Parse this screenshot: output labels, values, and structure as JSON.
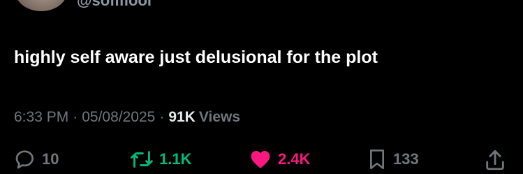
{
  "author": {
    "handle": "@sofiflool"
  },
  "tweet": {
    "text": "highly self aware just delusional for the plot",
    "time": "6:33 PM",
    "separator": "·",
    "date": "05/08/2025",
    "views_count": "91K",
    "views_label": "Views"
  },
  "actions": {
    "replies": "10",
    "reposts": "1.1K",
    "likes": "2.4K",
    "bookmarks": "133"
  },
  "colors": {
    "background": "#000000",
    "text": "#ffffff",
    "secondary": "#71767b",
    "repost_active": "#00ba7c",
    "like_active": "#f91880"
  },
  "icons": {
    "reply": "reply-icon",
    "repost": "repost-icon",
    "like": "heart-icon",
    "bookmark": "bookmark-icon",
    "share": "share-icon"
  }
}
